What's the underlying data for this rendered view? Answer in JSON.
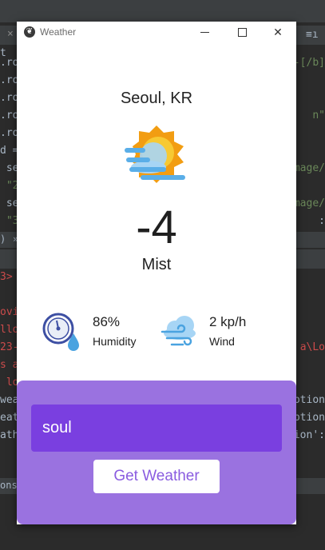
{
  "ide": {
    "tab_close": "×",
    "toolbar_right": "≡ı",
    "code_lines": [
      {
        "left": "t",
        "right": ""
      },
      {
        "left": ".ro",
        "right": "-[/b]"
      },
      {
        "left": ".ro",
        "right": ""
      },
      {
        "left": ".ro",
        "right": ""
      },
      {
        "left": ".ro",
        "right": "n\""
      },
      {
        "left": ".ro",
        "right": ""
      },
      {
        "left": "d =",
        "right": ""
      },
      {
        "left": " se",
        "right": "mage/"
      },
      {
        "left": " \"2",
        "right": ""
      },
      {
        "left": " se",
        "right": "mage/"
      },
      {
        "left": " \"3",
        "right": ":"
      }
    ],
    "split_left": ")",
    "split_mid": "»",
    "console_lines": [
      {
        "left": "3>",
        "right": ""
      },
      {
        "left": "",
        "right": ""
      },
      {
        "left": "ovi",
        "right": ""
      },
      {
        "left": "llo",
        "right": ""
      },
      {
        "left": "23-",
        "right": "a\\Lo"
      },
      {
        "left": "s a",
        "right": ""
      },
      {
        "left": " lo",
        "right": ""
      },
      {
        "left": "wea",
        "right": "ption"
      },
      {
        "left": "eat",
        "right": "ption"
      },
      {
        "left": "ath",
        "right": "ion':"
      }
    ],
    "status_text": "onsc"
  },
  "window": {
    "title": "Weather",
    "app_icon": "❦",
    "close_glyph": "✕"
  },
  "weather": {
    "city": "Seoul, KR",
    "temperature": "-4",
    "condition": "Mist",
    "humidity_value": "86%",
    "humidity_label": "Humidity",
    "wind_value": "2 kp/h",
    "wind_label": "Wind",
    "icon": "sun-behind-cloud-fog-icon"
  },
  "search": {
    "city_value": "soul",
    "button_label": "Get Weather"
  },
  "colors": {
    "panel": "#9a72e0",
    "input": "#7a3fe0",
    "button_text": "#8a5ce0"
  }
}
